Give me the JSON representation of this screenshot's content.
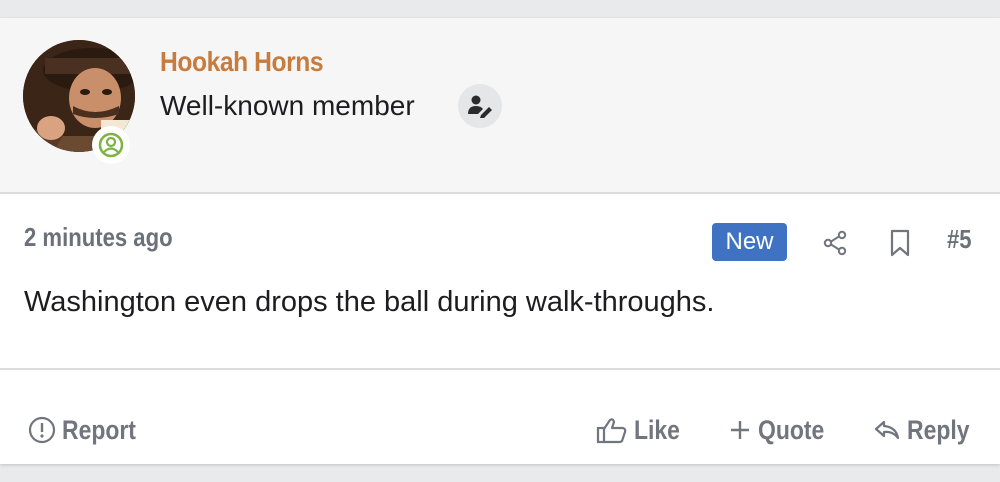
{
  "user": {
    "name": "Hookah Horns",
    "title": "Well-known member",
    "avatar_icon": "user-avatar-photo",
    "status_icon": "online-user-icon",
    "title_icon": "user-edit-icon"
  },
  "post": {
    "time": "2 minutes ago",
    "badge": "New",
    "number": "#5",
    "body": "Washington even drops the ball during walk-throughs."
  },
  "actions": {
    "report": "Report",
    "like": "Like",
    "quote": "Quote",
    "reply": "Reply"
  },
  "colors": {
    "username": "#c77c3e",
    "badge": "#3f72c2",
    "online": "#7cb342",
    "muted_text": "#6b7079"
  }
}
